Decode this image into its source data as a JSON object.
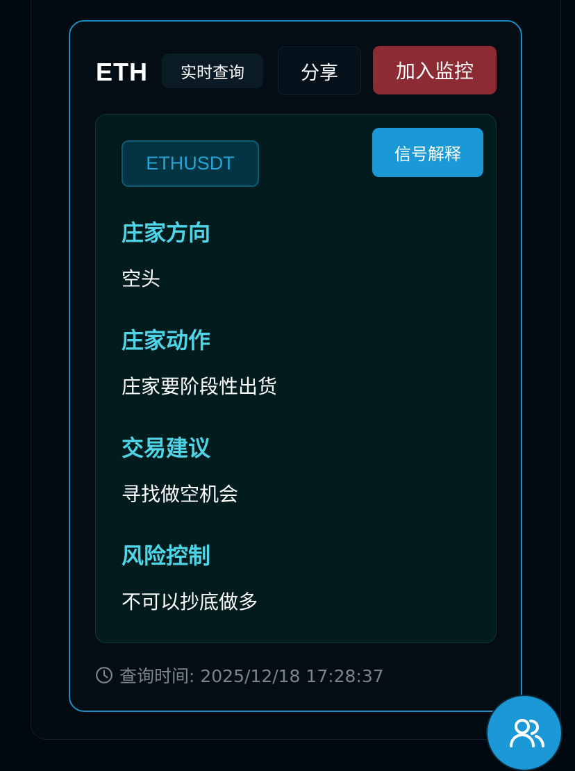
{
  "header": {
    "coin": "ETH",
    "badge": "实时查询",
    "share_label": "分享",
    "monitor_label": "加入监控"
  },
  "signal": {
    "symbol": "ETHUSDT",
    "explain_label": "信号解释",
    "fields": [
      {
        "label": "庄家方向",
        "value": "空头"
      },
      {
        "label": "庄家动作",
        "value": "庄家要阶段性出货"
      },
      {
        "label": "交易建议",
        "value": "寻找做空机会"
      },
      {
        "label": "风险控制",
        "value": "不可以抄底做多"
      }
    ]
  },
  "footer": {
    "query_time": "查询时间: 2025/12/18 17:28:37"
  },
  "icons": {
    "clock": "clock-icon",
    "fab": "users-icon"
  },
  "colors": {
    "accent": "#1a99d6",
    "danger": "#8c2b34",
    "label": "#4fd5e8"
  }
}
